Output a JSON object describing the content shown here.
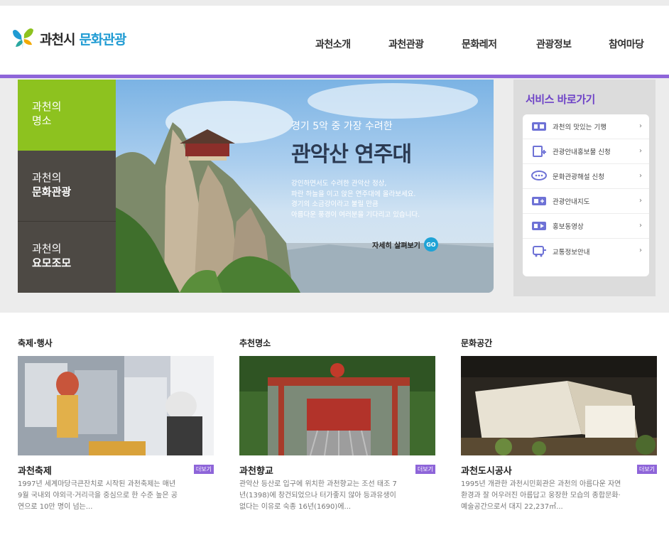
{
  "header": {
    "logo_city": "과천시",
    "logo_sub": "문화관광",
    "nav": [
      "과천소개",
      "과천관광",
      "문화레저",
      "관광정보",
      "참여마당"
    ]
  },
  "sidemenu": [
    {
      "line1": "과천의",
      "line2": "명소"
    },
    {
      "line1": "과천의",
      "line2": "문화관광"
    },
    {
      "line1": "과천의",
      "line2": "요모조모"
    }
  ],
  "hero": {
    "subtitle": "경기 5악 중 가장 수려한",
    "title": "관악산 연주대",
    "desc": [
      "강인하면서도 수려한 관악산 정상,",
      "파란 하늘을 이고 앉은 연주대에 올라보세요.",
      "경기의 소금강이라고 불릴 만큼",
      "아름다운 풍경이 여러분을 기다리고 있습니다."
    ],
    "more": "자세히 살펴보기",
    "go": "GO"
  },
  "service": {
    "title": "서비스 바로가기",
    "items": [
      {
        "label": "과천의 맛있는 기행",
        "icon": "book-icon"
      },
      {
        "label": "관광안내홍보물 신청",
        "icon": "document-plus-icon"
      },
      {
        "label": "문화관광해설 신청",
        "icon": "speech-bubble-icon"
      },
      {
        "label": "관광안내지도",
        "icon": "map-icon"
      },
      {
        "label": "홍보동영상",
        "icon": "video-play-icon"
      },
      {
        "label": "교통정보안내",
        "icon": "bus-icon"
      }
    ],
    "arrow": "›"
  },
  "cards": [
    {
      "category": "축제·행사",
      "title": "과천축제",
      "more": "더보기",
      "desc": [
        "1997년 세계마당극큰잔치로 시작된 과천축제는 매년",
        "9월 국내외 야외극·거리극을 중심으로 한 수준 높은 공",
        "연으로 10만 명이 넘는..."
      ]
    },
    {
      "category": "추천명소",
      "title": "과천향교",
      "more": "더보기",
      "desc": [
        "관악산 등산로 입구에 위치한 과천향교는 조선 태조 7",
        "년(1398)에 창건되었으나 터가좋지 않아 등과유생이",
        "없다는 이유로 숙종 16년(1690)에..."
      ]
    },
    {
      "category": "문화공간",
      "title": "과천도시공사",
      "more": "더보기",
      "desc": [
        "1995년 개관한 과천시민회관은 과천의 아름다운 자연",
        "환경과 잘 어우러진 아름답고 웅장한 모습의 종합문화·",
        "예술공간으로서 대지 22,237㎡..."
      ]
    }
  ],
  "colors": {
    "accent": "#8e65d9",
    "service_title": "#6e43c7",
    "sidemenu_active": "#8dc21f",
    "sidemenu_dark": "#4d4944",
    "logo_sub": "#1f9bd3",
    "go_button": "#1fa3d6"
  }
}
